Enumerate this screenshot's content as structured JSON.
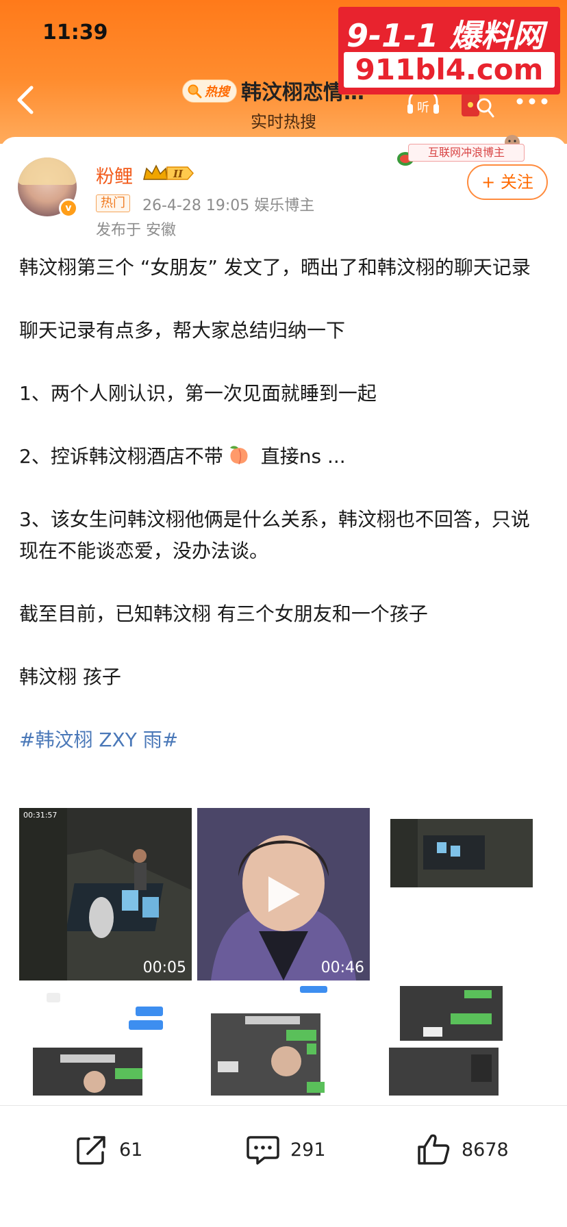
{
  "status_bar": {
    "time": "11:39"
  },
  "watermark": {
    "top": "9-1-1 爆料网",
    "bottom": "911bl4.com"
  },
  "header": {
    "hot_badge": "热搜",
    "title": "韩汶栩恋情…",
    "subtitle": "实时热搜",
    "listen_label": "听"
  },
  "post": {
    "user_name": "粉鲤",
    "level": "II",
    "hot_tag": "热门",
    "time_and_role": "26-4-28 19:05  娱乐博主",
    "location": "发布于 安徽",
    "follow_label": "+ 关注",
    "banner_text": "互联网冲浪博主",
    "paragraphs": {
      "p1": "韩汶栩第三个 “女朋友” 发文了，晒出了和韩汶栩的聊天记录",
      "p2": "聊天记录有点多，帮大家总结归纳一下",
      "p3": "1、两个人刚认识，第一次见面就睡到一起",
      "p4a": "2、控诉韩汶栩酒店不带",
      "p4b": " 直接ns ...",
      "p5": "3、该女生问韩汶栩他俩是什么关系，韩汶栩也不回答，只说现在不能谈恋爱，没办法谈。",
      "p6": "截至目前，已知韩汶栩 有三个女朋友和一个孩子",
      "p7": "韩汶栩 孩子",
      "hashtag": "#韩汶栩 ZXY 雨#"
    },
    "media": {
      "video1_duration": "00:05",
      "video1_timestamp": "00:31:57",
      "video2_duration": "00:46"
    }
  },
  "actions": {
    "share_count": "61",
    "comment_count": "291",
    "like_count": "8678"
  },
  "colors": {
    "header_orange": "#ff7a1a",
    "accent": "#ff6a00",
    "hashtag": "#4a78b8",
    "watermark_red": "#e8232e"
  }
}
